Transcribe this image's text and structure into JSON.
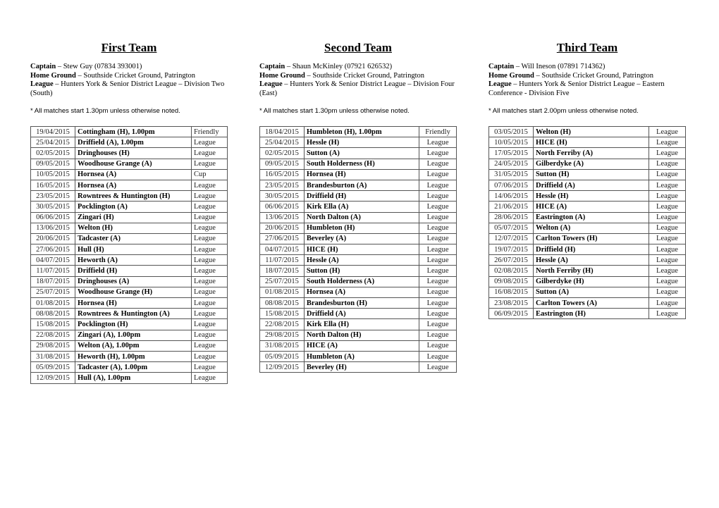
{
  "teams": [
    {
      "title": "First Team",
      "captain_label": "Captain",
      "captain": "Stew Guy (07834 393001)",
      "ground_label": "Home Ground",
      "ground": "Southside Cricket Ground, Patrington",
      "league_label": "League",
      "league": "Hunters York & Senior District League – Division Two (South)",
      "note": "* All matches start 1.30pm unless otherwise noted.",
      "fixtures": [
        [
          "19/04/2015",
          "Cottingham (H), 1.00pm",
          "Friendly"
        ],
        [
          "25/04/2015",
          "Driffield (A), 1.00pm",
          "League"
        ],
        [
          "02/05/2015",
          "Dringhouses (H)",
          "League"
        ],
        [
          "09/05/2015",
          "Woodhouse Grange (A)",
          "League"
        ],
        [
          "10/05/2015",
          "Hornsea (A)",
          "Cup"
        ],
        [
          "16/05/2015",
          "Hornsea (A)",
          "League"
        ],
        [
          "23/05/2015",
          "Rowntrees & Huntington (H)",
          "League"
        ],
        [
          "30/05/2015",
          "Pocklington (A)",
          "League"
        ],
        [
          "06/06/2015",
          "Zingari (H)",
          "League"
        ],
        [
          "13/06/2015",
          "Welton (H)",
          "League"
        ],
        [
          "20/06/2015",
          "Tadcaster (A)",
          "League"
        ],
        [
          "27/06/2015",
          "Hull (H)",
          "League"
        ],
        [
          "04/07/2015",
          "Heworth (A)",
          "League"
        ],
        [
          "11/07/2015",
          "Driffield (H)",
          "League"
        ],
        [
          "18/07/2015",
          "Dringhouses (A)",
          "League"
        ],
        [
          "25/07/2015",
          "Woodhouse Grange (H)",
          "League"
        ],
        [
          "01/08/2015",
          "Hornsea (H)",
          "League"
        ],
        [
          "08/08/2015",
          "Rowntrees & Huntington (A)",
          "League"
        ],
        [
          "15/08/2015",
          "Pocklington (H)",
          "League"
        ],
        [
          "22/08/2015",
          "Zingari (A), 1.00pm",
          "League"
        ],
        [
          "29/08/2015",
          "Welton (A), 1.00pm",
          "League"
        ],
        [
          "31/08/2015",
          "Heworth (H), 1.00pm",
          "League"
        ],
        [
          "05/09/2015",
          "Tadcaster (A), 1.00pm",
          "League"
        ],
        [
          "12/09/2015",
          "Hull (A), 1.00pm",
          "League"
        ]
      ]
    },
    {
      "title": "Second Team",
      "captain_label": "Captain",
      "captain": "Shaun McKinley (07921 626532)",
      "ground_label": "Home Ground",
      "ground": "Southside Cricket Ground, Patrington",
      "league_label": "League",
      "league": "Hunters York & Senior District League – Division Four (East)",
      "note": "* All matches start 1.30pm unless otherwise noted.",
      "fixtures": [
        [
          "18/04/2015",
          "Humbleton (H), 1.00pm",
          "Friendly"
        ],
        [
          "25/04/2015",
          "Hessle (H)",
          "League"
        ],
        [
          "02/05/2015",
          "Sutton (A)",
          "League"
        ],
        [
          "09/05/2015",
          "South Holderness (H)",
          "League"
        ],
        [
          "16/05/2015",
          "Hornsea (H)",
          "League"
        ],
        [
          "23/05/2015",
          "Brandesburton (A)",
          "League"
        ],
        [
          "30/05/2015",
          "Driffield (H)",
          "League"
        ],
        [
          "06/06/2015",
          "Kirk Ella (A)",
          "League"
        ],
        [
          "13/06/2015",
          "North Dalton (A)",
          "League"
        ],
        [
          "20/06/2015",
          "Humbleton (H)",
          "League"
        ],
        [
          "27/06/2015",
          "Beverley (A)",
          "League"
        ],
        [
          "04/07/2015",
          "HICE (H)",
          "League"
        ],
        [
          "11/07/2015",
          "Hessle (A)",
          "League"
        ],
        [
          "18/07/2015",
          "Sutton (H)",
          "League"
        ],
        [
          "25/07/2015",
          "South Holderness (A)",
          "League"
        ],
        [
          "01/08/2015",
          "Hornsea (A)",
          "League"
        ],
        [
          "08/08/2015",
          "Brandesburton (H)",
          "League"
        ],
        [
          "15/08/2015",
          "Driffield (A)",
          "League"
        ],
        [
          "22/08/2015",
          "Kirk Ella (H)",
          "League"
        ],
        [
          "29/08/2015",
          "North Dalton (H)",
          "League"
        ],
        [
          "31/08/2015",
          "HICE (A)",
          "League"
        ],
        [
          "05/09/2015",
          "Humbleton (A)",
          "League"
        ],
        [
          "12/09/2015",
          "Beverley (H)",
          "League"
        ]
      ]
    },
    {
      "title": "Third Team",
      "captain_label": "Captain",
      "captain": "Will Ineson (07891 714362)",
      "ground_label": "Home Ground",
      "ground": "Southside Cricket Ground, Patrington",
      "league_label": "League",
      "league": "Hunters York & Senior District League – Eastern Conference - Division Five",
      "note": "* All matches start 2.00pm unless otherwise noted.",
      "fixtures": [
        [
          "03/05/2015",
          "Welton (H)",
          "League"
        ],
        [
          "10/05/2015",
          "HICE (H)",
          "League"
        ],
        [
          "17/05/2015",
          "North Ferriby (A)",
          "League"
        ],
        [
          "24/05/2015",
          "Gilberdyke (A)",
          "League"
        ],
        [
          "31/05/2015",
          "Sutton (H)",
          "League"
        ],
        [
          "07/06/2015",
          "Driffield (A)",
          "League"
        ],
        [
          "14/06/2015",
          "Hessle (H)",
          "League"
        ],
        [
          "21/06/2015",
          "HICE (A)",
          "League"
        ],
        [
          "28/06/2015",
          "Eastrington (A)",
          "League"
        ],
        [
          "05/07/2015",
          "Welton (A)",
          "League"
        ],
        [
          "12/07/2015",
          "Carlton Towers (H)",
          "League"
        ],
        [
          "19/07/2015",
          "Driffield (H)",
          "League"
        ],
        [
          "26/07/2015",
          "Hessle (A)",
          "League"
        ],
        [
          "02/08/2015",
          "North Ferriby (H)",
          "League"
        ],
        [
          "09/08/2015",
          "Gilberdyke (H)",
          "League"
        ],
        [
          "16/08/2015",
          "Sutton (A)",
          "League"
        ],
        [
          "23/08/2015",
          "Carlton Towers (A)",
          "League"
        ],
        [
          "06/09/2015",
          "Eastrington (H)",
          "League"
        ]
      ]
    }
  ]
}
